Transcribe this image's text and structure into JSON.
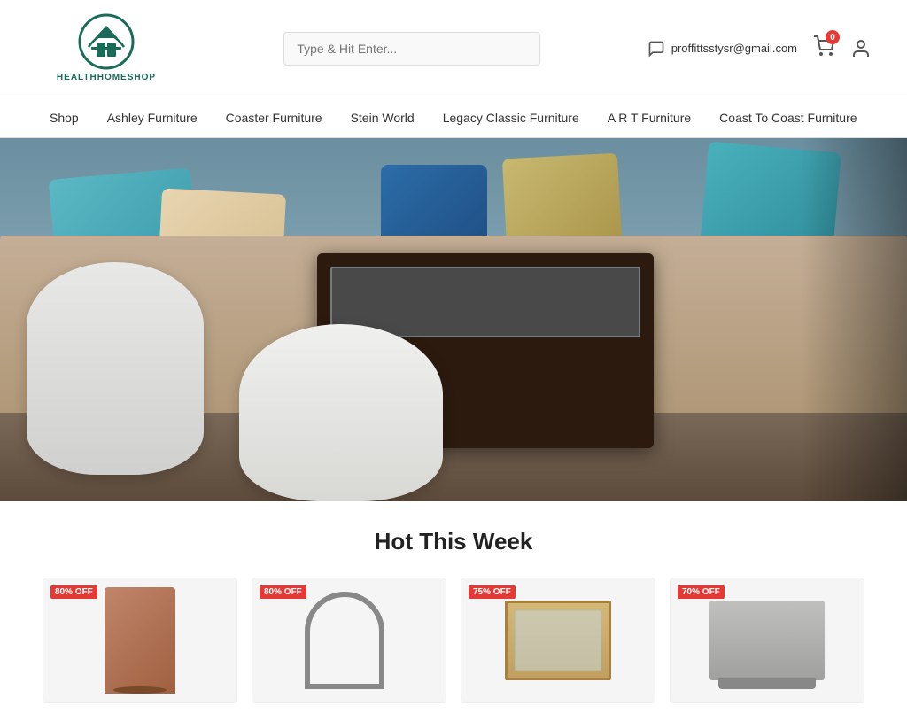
{
  "header": {
    "logo_text": "HEALTHHOMESHOP",
    "search_placeholder": "Type & Hit Enter...",
    "email": "proffittsstysr@gmail.com",
    "cart_badge": "0"
  },
  "navbar": {
    "items": [
      {
        "id": "shop",
        "label": "Shop"
      },
      {
        "id": "ashley",
        "label": "Ashley Furniture"
      },
      {
        "id": "coaster",
        "label": "Coaster Furniture"
      },
      {
        "id": "stein",
        "label": "Stein World"
      },
      {
        "id": "legacy",
        "label": "Legacy Classic Furniture"
      },
      {
        "id": "art",
        "label": "A R T Furniture"
      },
      {
        "id": "coast",
        "label": "Coast To Coast Furniture"
      }
    ]
  },
  "hot_section": {
    "title": "Hot This Week",
    "products": [
      {
        "id": "p1",
        "discount": "80% OFF",
        "type": "chair"
      },
      {
        "id": "p2",
        "discount": "80% OFF",
        "type": "arch"
      },
      {
        "id": "p3",
        "discount": "75% OFF",
        "type": "table"
      },
      {
        "id": "p4",
        "discount": "70% OFF",
        "type": "ottoman"
      }
    ]
  }
}
